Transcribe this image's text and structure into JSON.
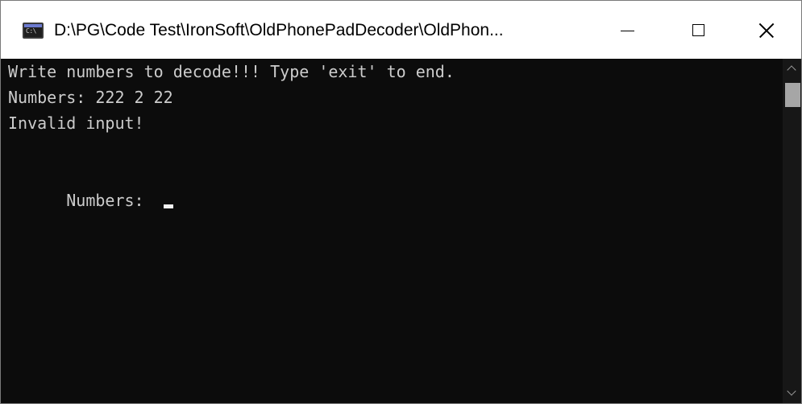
{
  "window": {
    "title": "D:\\PG\\Code Test\\IronSoft\\OldPhonePadDecoder\\OldPhon...",
    "icon": "console-icon",
    "icon_text": "C:\\",
    "controls": {
      "minimize_icon": "minimize-icon",
      "maximize_icon": "maximize-icon",
      "close_icon": "close-icon"
    }
  },
  "console": {
    "lines": [
      "Write numbers to decode!!! Type 'exit' to end.",
      "Numbers: 222 2 22",
      "Invalid input!",
      ""
    ],
    "prompt": "Numbers: "
  },
  "colors": {
    "console_background": "#0c0c0c",
    "console_text": "#cccccc",
    "titlebar_background": "#ffffff",
    "scrollbar_thumb": "#a6a6a6"
  }
}
